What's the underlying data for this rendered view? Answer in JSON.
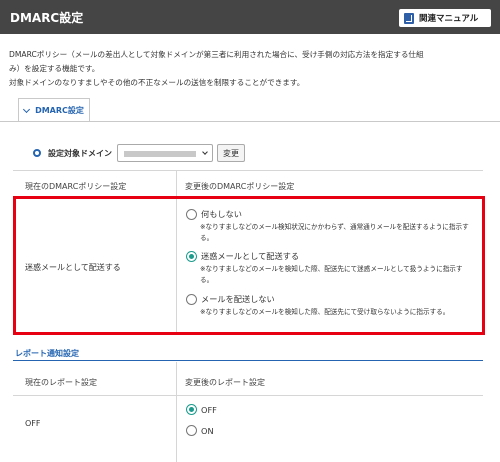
{
  "header": {
    "title": "DMARC設定",
    "manual_label": "関連マニュアル"
  },
  "description": {
    "line1": "DMARCポリシー（メールの差出人として対象ドメインが第三者に利用された場合に、受け手側の対応方法を指定する仕組",
    "line2": "み）を設定する機能です。",
    "line3": "対象ドメインのなりすましやその他の不正なメールの送信を制限することができます。"
  },
  "tab": {
    "label": "DMARC設定"
  },
  "domain": {
    "label": "設定対象ドメイン",
    "change_label": "変更"
  },
  "policy_table": {
    "col_current": "現在のDMARCポリシー設定",
    "col_new": "変更後のDMARCポリシー設定",
    "current_value": "迷惑メールとして配送する",
    "options": [
      {
        "label": "何もしない",
        "note": "※なりすましなどのメール検知状況にかかわらず、通常通りメールを配送するように指示する。",
        "selected": false
      },
      {
        "label": "迷惑メールとして配送する",
        "note": "※なりすましなどのメールを検知した際、配送先にて迷惑メールとして扱うように指示する。",
        "selected": true
      },
      {
        "label": "メールを配送しない",
        "note": "※なりすましなどのメールを検知した際、配送先にて受け取らないように指示する。",
        "selected": false
      }
    ]
  },
  "report_section": {
    "title": "レポート通知設定",
    "col_current": "現在のレポート設定",
    "col_new": "変更後のレポート設定",
    "current_value": "OFF",
    "options": [
      {
        "label": "OFF",
        "selected": true
      },
      {
        "label": "ON",
        "selected": false
      }
    ]
  },
  "colors": {
    "accent": "#2464b0",
    "highlight_border": "#e60012",
    "radio_selected": "#1a9b8c",
    "header_bg": "#454545"
  }
}
